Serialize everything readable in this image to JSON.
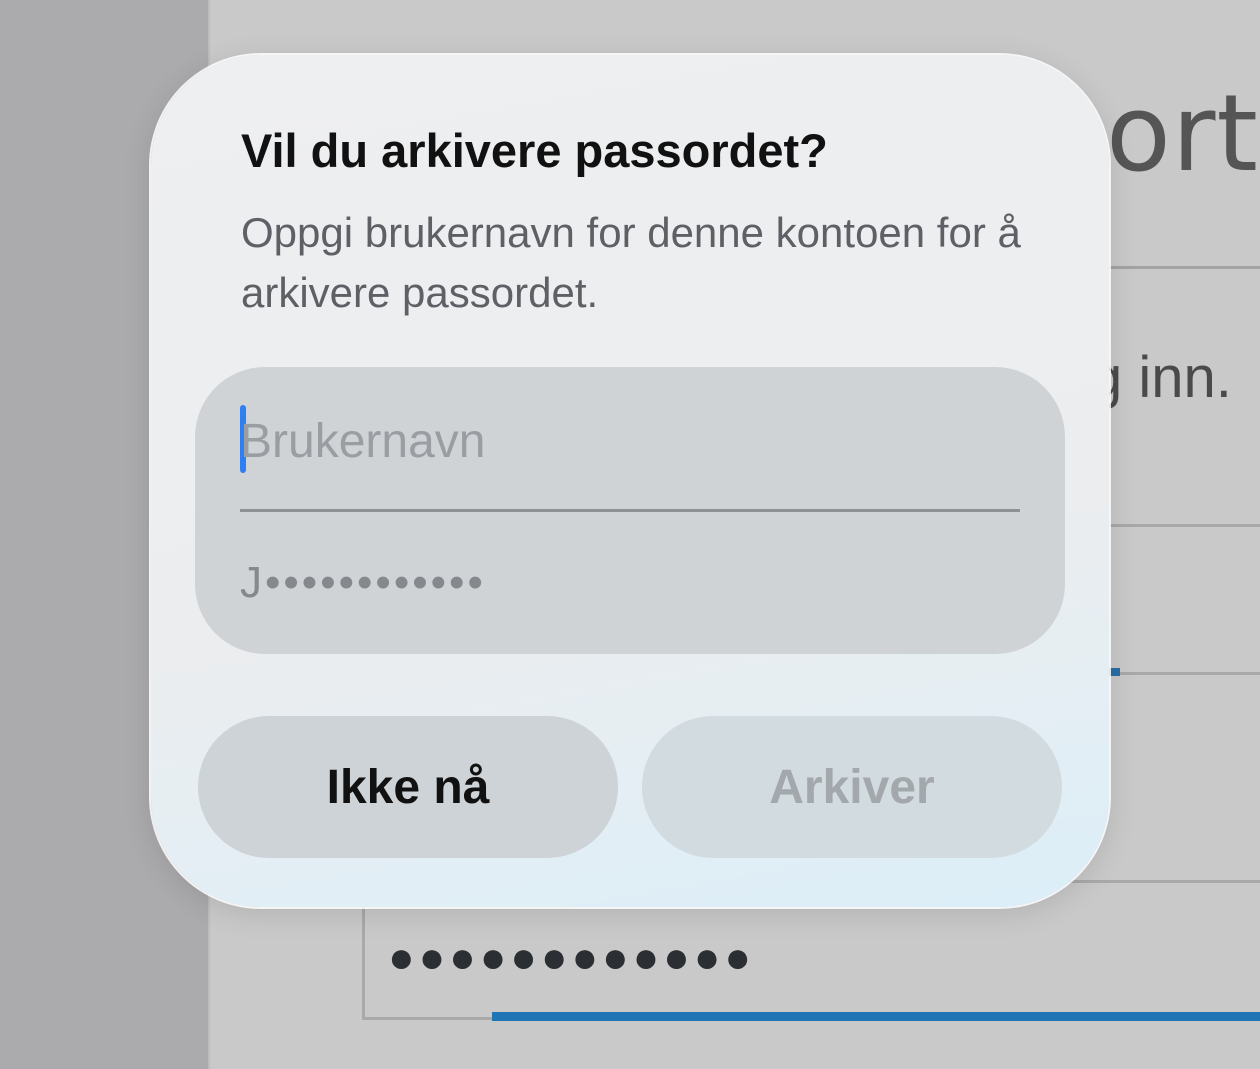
{
  "background": {
    "heading_fragment": "orta",
    "subtext_fragment": "g inn.",
    "password_dots": "●●●●●●●●●●●●"
  },
  "dialog": {
    "title": "Vil du arkivere passordet?",
    "message": "Oppgi brukernavn for denne kontoen for å arkivere passordet.",
    "username_field": {
      "value": "",
      "placeholder": "Brukernavn"
    },
    "password_field": {
      "value": "J••••••••••••"
    },
    "buttons": {
      "cancel_label": "Ikke nå",
      "archive_label": "Arkiver",
      "archive_enabled": false
    }
  },
  "colors": {
    "caret": "#2f7ff0",
    "focus_underline": "#2076b4"
  }
}
